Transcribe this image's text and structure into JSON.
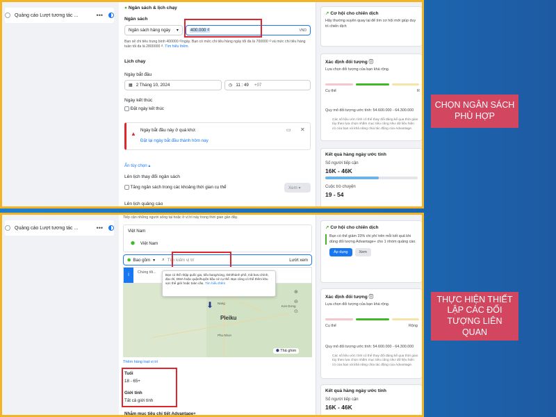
{
  "panel1": {
    "campaign_name": "Quảng cáo Lượt tương tác ...",
    "section_title": "Ngân sách & lịch chạy",
    "budget_label": "Ngân sách",
    "budget_type": "Ngân sách hàng ngày",
    "budget_value": "400.000 ₫",
    "currency": "VND",
    "budget_note": "Bạn sẽ chi tiêu trung bình 400000 ₫/ngày. Bạn có mức chi tiêu hàng ngày tối đa là 700000 ₫ và mức chi tiêu hàng tuần tối đa là 2800000 ₫.",
    "budget_note_link": "Tìm hiểu thêm.",
    "schedule_label": "Lịch chạy",
    "start_label": "Ngày bắt đầu",
    "start_date": "2 Tháng 10, 2024",
    "start_time": "11 : 49",
    "timezone": "+07",
    "end_label": "Ngày kết thúc",
    "end_checkbox": "Đặt ngày kết thúc",
    "warning_title": "Ngày bắt đầu này ở quá khứ.",
    "warning_link": "Đặt lại ngày bắt đầu thành hôm nay",
    "hide_options": "Ẩn tùy chọn",
    "budget_schedule_label": "Lên lịch thay đổi ngân sách",
    "budget_schedule_checkbox": "Tăng ngân sách trong các khoảng thời gian cụ thể",
    "view_button": "Xem",
    "ad_schedule_label": "Lên lịch quảng cáo",
    "right": {
      "opportunity_title": "Cơ hội cho chiến dịch",
      "opportunity_text": "Hãy thường xuyên quay lại để tìm cơ hội mới giúp duy trì chiến dịch",
      "audience_title": "Xác định đối tượng",
      "audience_text": "Lựa chọn đối tượng của bạn khá rộng.",
      "specific": "Cụ thể",
      "broad": "R",
      "audience_size": "Quy mô đối tượng ước tính: 54.600.000 - 64.300.000",
      "audience_disclaimer": "Các số liệu ước tính có thể thay đổi đáng kể qua thời gian tùy theo lựa chọn nhắm mục tiêu cũng như dữ liệu hiện có của bạn và khả năng chia tác động của Advantage.",
      "results_title": "Kết quả hàng ngày ước tính",
      "reach_label": "Số người tiếp cận",
      "reach_value": "16K - 46K",
      "conv_label": "Cuộc trò chuyện",
      "conv_value": "19 - 54"
    }
  },
  "panel2": {
    "campaign_name": "Quảng cáo Lượt tương tác ...",
    "top_note": "Tiếp cận những người sống tại hoặc ở vị trí này trong thời gian gần đây.",
    "country_label": "Việt Nam",
    "country_value": "Việt Nam",
    "include_label": "Bao gồm",
    "search_placeholder": "Tìm kiếm vị trí",
    "browse_link": "Lướt xem",
    "tooltip_text": "Bạn có thể nhập quốc gia, tiểu bang/vùng, tỉnh/thành phố, mã bưu chính, địa chỉ, DMA hoặc quận/huyện bầu cử cụ thể. Bạn cũng có thể thêm khu vực thể giới hoặc toàn cầu.",
    "tooltip_link": "Tìm hiểu thêm",
    "info_text": "Chúng tôi...",
    "map_city": "Pleiku",
    "map_places": [
      "Kon Dơng",
      "Phu Nhon",
      "Nang",
      "Kon"
    ],
    "drop_pin": "Thả ghim",
    "show_locations": "Thêm hàng loạt vị trí",
    "age_label": "Tuổi",
    "age_value": "18 - 65+",
    "gender_label": "Giới tính",
    "gender_value": "Tất cả giới tính",
    "advantage_label": "Nhắm mục tiêu chi tiết Advantage+",
    "right": {
      "opportunity_title": "Cơ hội cho chiến dịch",
      "opportunity_text": "Bạn có thể giảm 33% chi phí trên mỗi kết quả khi dùng đối tượng Advantage+ cho 1 nhóm quảng cáo.",
      "apply_button": "Áp dụng",
      "view_button": "Xem",
      "audience_title": "Xác định đối tượng",
      "audience_text": "Lựa chọn đối tượng của bạn khá rộng.",
      "specific": "Cụ thể",
      "broad": "Rộng",
      "audience_size": "Quy mô đối tượng ước tính: 54.600.000 - 64.300.000",
      "audience_disclaimer": "Các số liệu ước tính có thể thay đổi đáng kể qua thời gian tùy theo lựa chọn nhắm mục tiêu cũng như dữ liệu hiện có của bạn và khả năng chia tác động của Advantage.",
      "results_title": "Kết quả hàng ngày ước tính",
      "reach_label": "Số người tiếp cận",
      "reach_value": "16K - 46K"
    }
  },
  "callouts": {
    "top": "CHỌN NGÂN SÁCH PHÙ HỢP",
    "bottom": "THỰC HIỆN THIẾT LẬP CÁC ĐỐI TƯỢNG LIÊN QUAN"
  },
  "colors": {
    "frame": "#f2b325",
    "highlight": "#e0262d",
    "callout": "#d2465f",
    "accent": "#1877f2"
  }
}
